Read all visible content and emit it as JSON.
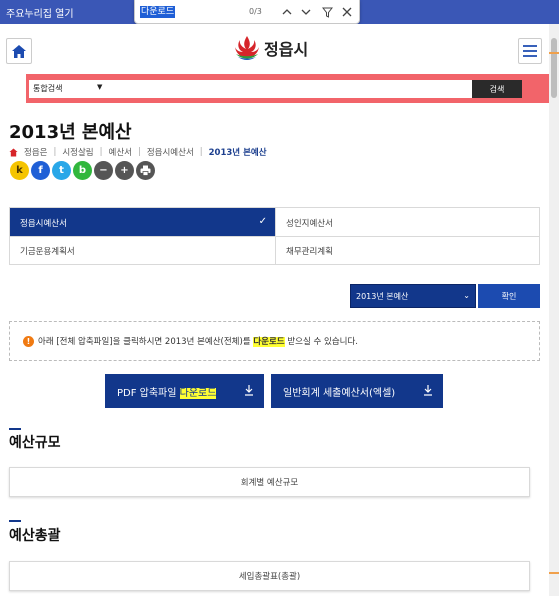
{
  "topbar": {
    "skip_link": "주요누리집 열기"
  },
  "findbar": {
    "query": "다운로드",
    "count": "0/3"
  },
  "header": {
    "logo_text": "정읍시"
  },
  "search": {
    "select_value": "통합검색",
    "button_label": "검색"
  },
  "page": {
    "title": "2013년 본예산",
    "breadcrumb": [
      "정읍은",
      "시정살림",
      "예산서",
      "정읍시예산서",
      "2013년 본예산"
    ]
  },
  "share": {
    "kakao": "k",
    "facebook": "f",
    "twitter": "t",
    "band": "b",
    "zoom_out": "−",
    "zoom_in": "+",
    "print_icon": "print-icon"
  },
  "tabs": [
    "정읍시예산서",
    "성인지예산서",
    "기금운용계획서",
    "채무관리계획"
  ],
  "year_select": {
    "value": "2013년 본예산",
    "confirm_label": "확인"
  },
  "notice": {
    "icon": "!",
    "before": "아래 [전체 압축파일]을 클릭하시면 2013년 본예산(전체)를 ",
    "highlight": "다운로드",
    "after": " 받으실 수 있습니다."
  },
  "downloads": {
    "pdf_prefix": "PDF 압축파일 ",
    "pdf_highlight": "다운로드",
    "excel_label": "일반회계 세출예산서(엑셀)"
  },
  "sections": {
    "scale_title": "예산규모",
    "scale_item": "회계별 예산규모",
    "overview_title": "예산총괄",
    "overview_item": "세입총괄표(총괄)"
  },
  "colors": {
    "primary": "#12378b",
    "search_band": "#f2646a",
    "highlight": "#ffff33",
    "top_bar": "#3a57b6"
  }
}
